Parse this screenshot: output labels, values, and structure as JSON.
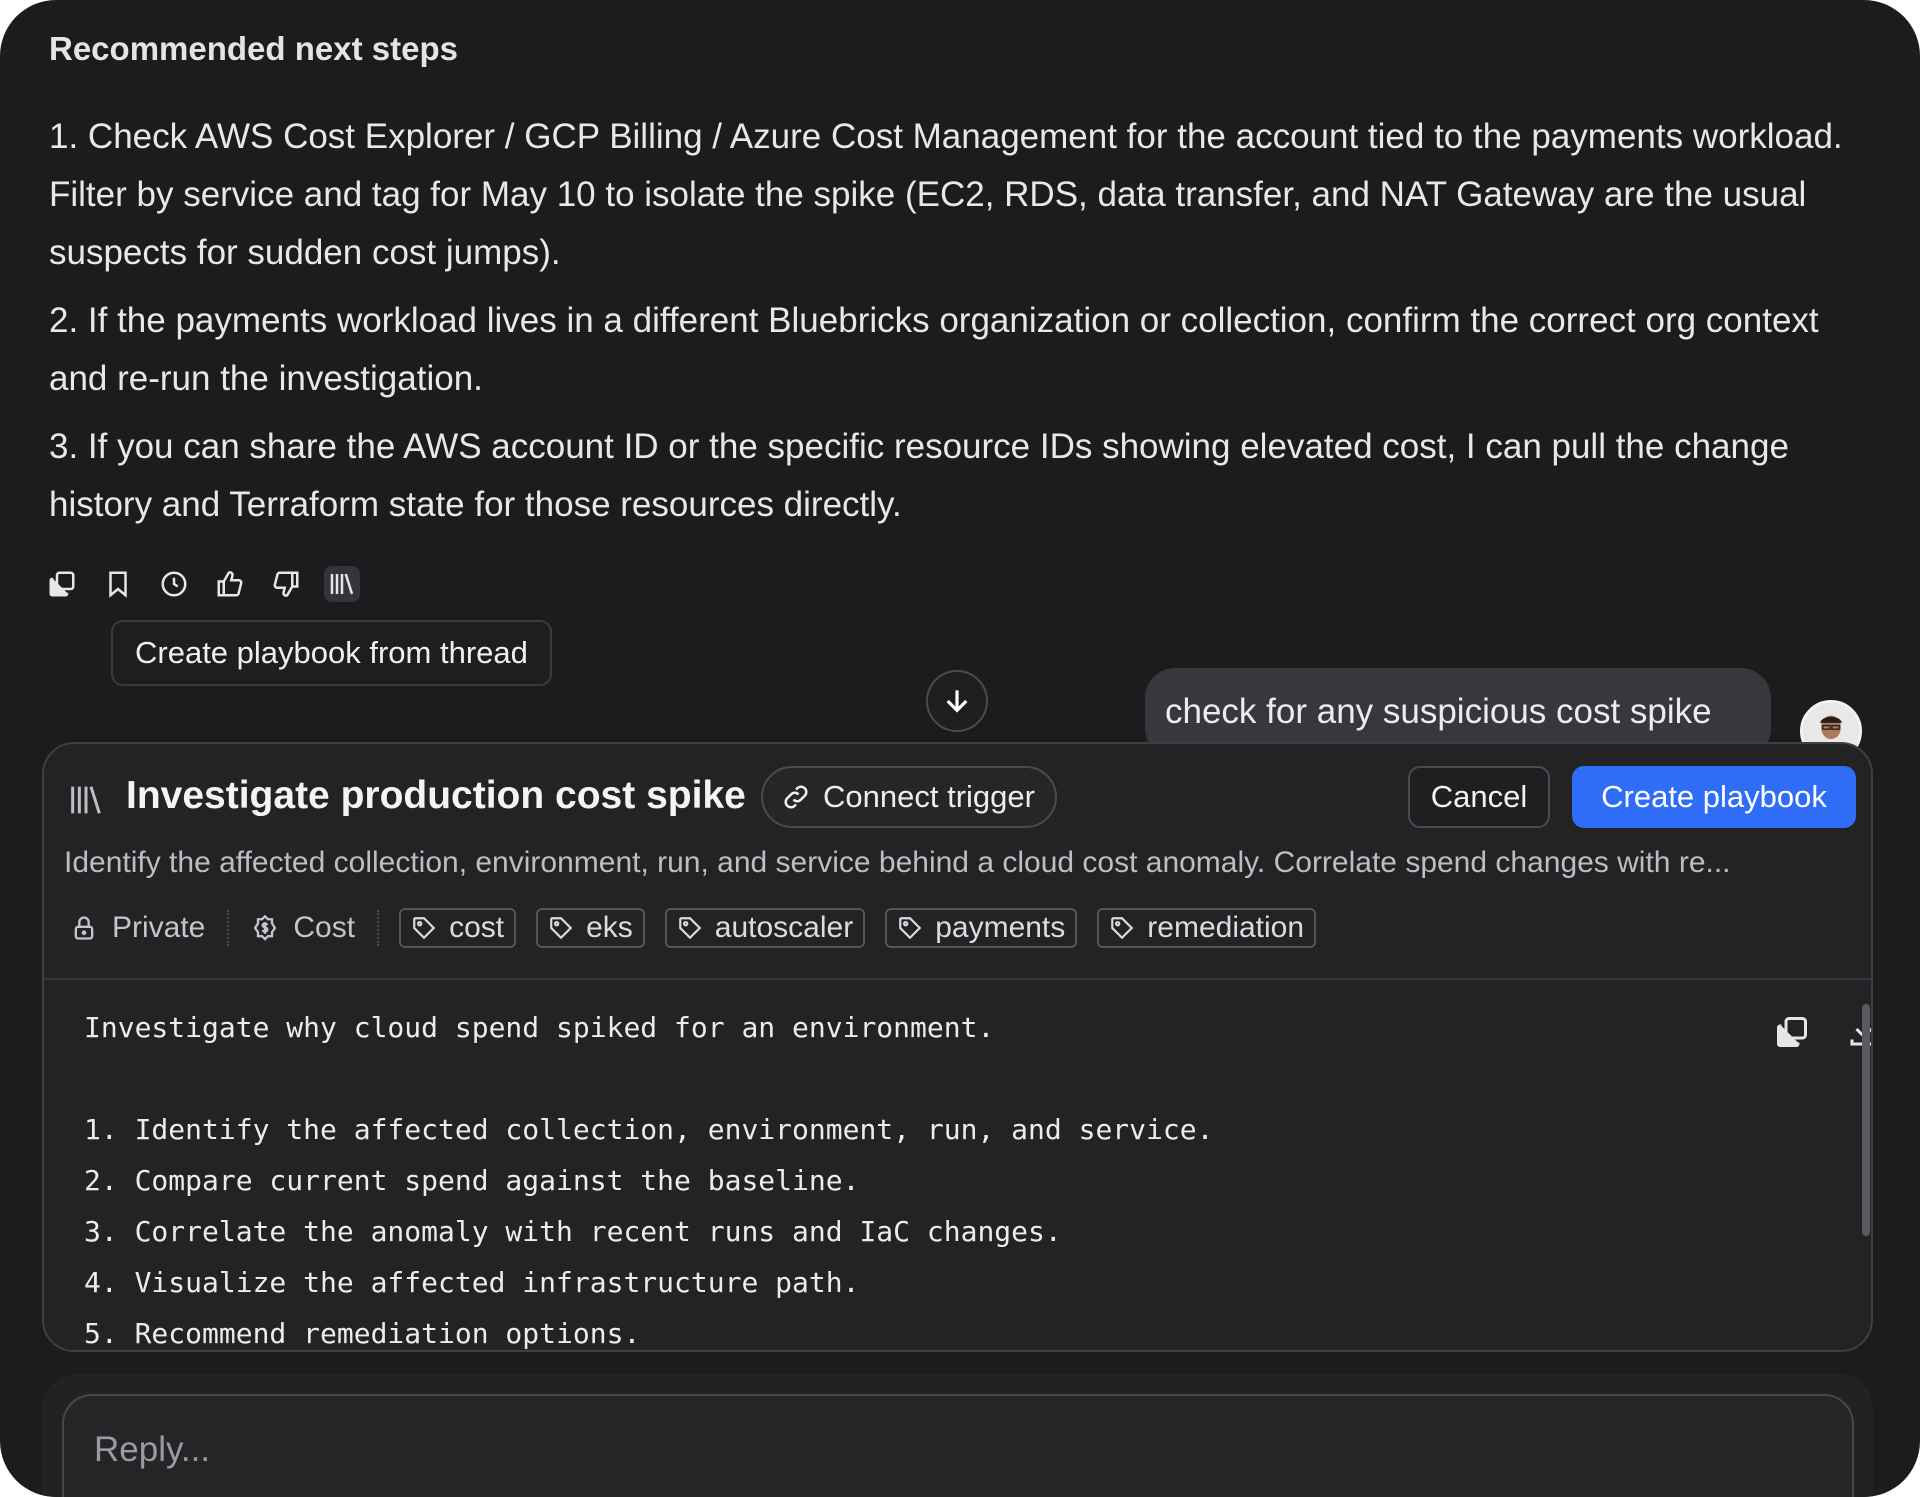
{
  "section_title": "Recommended next steps",
  "steps": [
    "1. Check AWS Cost Explorer / GCP Billing / Azure Cost Management for the account tied to the payments workload. Filter by service and tag for May 10 to isolate the spike (EC2, RDS, data transfer, and NAT Gateway are the usual suspects for sudden cost jumps).",
    "2. If the payments workload lives in a different Bluebricks organization or collection, confirm the correct org context and re-run the investigation.",
    "3. If you can share the AWS account ID or the specific resource IDs showing elevated cost, I can pull the change history and Terraform state for those resources directly."
  ],
  "tooltip": "Create playbook from thread",
  "user_message": "check for any suspicious cost spike",
  "panel": {
    "title": "Investigate production cost spike",
    "connect_trigger": "Connect trigger",
    "cancel": "Cancel",
    "create": "Create playbook",
    "description": "Identify the affected collection, environment, run, and service behind a cloud cost anomaly. Correlate spend changes with re...",
    "visibility": "Private",
    "category": "Cost",
    "tags": [
      "cost",
      "eks",
      "autoscaler",
      "payments",
      "remediation"
    ],
    "code_lines": [
      "Investigate why cloud spend spiked for an environment.",
      "",
      "1. Identify the affected collection, environment, run, and service.",
      "2. Compare current spend against the baseline.",
      "3. Correlate the anomaly with recent runs and IaC changes.",
      "4. Visualize the affected infrastructure path.",
      "5. Recommend remediation options."
    ]
  },
  "reply": {
    "placeholder": "Reply..."
  },
  "colors": {
    "accent": "#2f6df6",
    "background": "#1c1c1e",
    "panel": "#232326"
  }
}
